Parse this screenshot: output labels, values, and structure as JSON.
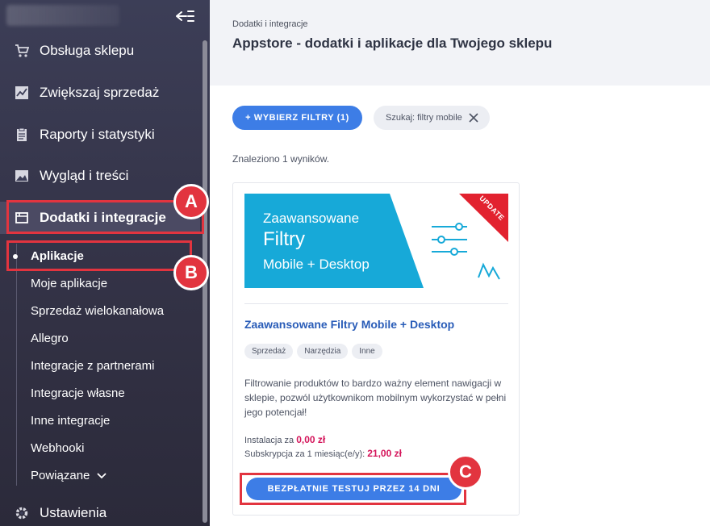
{
  "sidebar": {
    "items": [
      {
        "label": "Obsługa sklepu",
        "icon": "cart-icon"
      },
      {
        "label": "Zwiększaj sprzedaż",
        "icon": "trend-chart-icon"
      },
      {
        "label": "Raporty i statystyki",
        "icon": "clipboard-icon"
      },
      {
        "label": "Wygląd i treści",
        "icon": "image-icon"
      },
      {
        "label": "Dodatki i integracje",
        "icon": "window-icon"
      }
    ],
    "subitems": [
      {
        "label": "Aplikacje"
      },
      {
        "label": "Moje aplikacje"
      },
      {
        "label": "Sprzedaż wielokanałowa"
      },
      {
        "label": "Allegro"
      },
      {
        "label": "Integracje z partnerami"
      },
      {
        "label": "Integracje własne"
      },
      {
        "label": "Inne integracje"
      },
      {
        "label": "Webhooki"
      },
      {
        "label": "Powiązane"
      }
    ],
    "settings": {
      "label": "Ustawienia",
      "icon": "gear-icon"
    }
  },
  "markers": {
    "a": "A",
    "b": "B",
    "c": "C"
  },
  "header": {
    "breadcrumb": "Dodatki i integracje",
    "title": "Appstore - dodatki i aplikacje dla Twojego sklepu"
  },
  "filters": {
    "button_label": "+ WYBIERZ FILTRY (1)",
    "search_chip": "Szukaj: filtry mobile"
  },
  "results_text": "Znaleziono 1 wyników.",
  "app_card": {
    "banner": {
      "line1": "Zaawansowane",
      "line2": "Filtry",
      "line3": "Mobile + Desktop",
      "ribbon": "UPDATE"
    },
    "title": "Zaawansowane Filtry Mobile + Desktop",
    "tags": [
      "Sprzedaż",
      "Narzędzia",
      "Inne"
    ],
    "description": "Filtrowanie produktów to bardzo ważny element nawigacji w sklepie, pozwól użytkownikom mobilnym wykorzystać w pełni jego potencjał!",
    "install_label": "Instalacja za",
    "install_price": "0,00 zł",
    "subscription_label": "Subskrypcja za 1 miesiąc(e/y):",
    "subscription_price": "21,00 zł",
    "cta_label": "BEZPŁATNIE TESTUJ PRZEZ 14 DNI"
  },
  "colors": {
    "sidebar_bg": "#3c3e57",
    "accent_blue": "#3d7de6",
    "highlight_red": "#e2343f",
    "price_color": "#d4145a",
    "banner_cyan": "#17a9d8"
  }
}
